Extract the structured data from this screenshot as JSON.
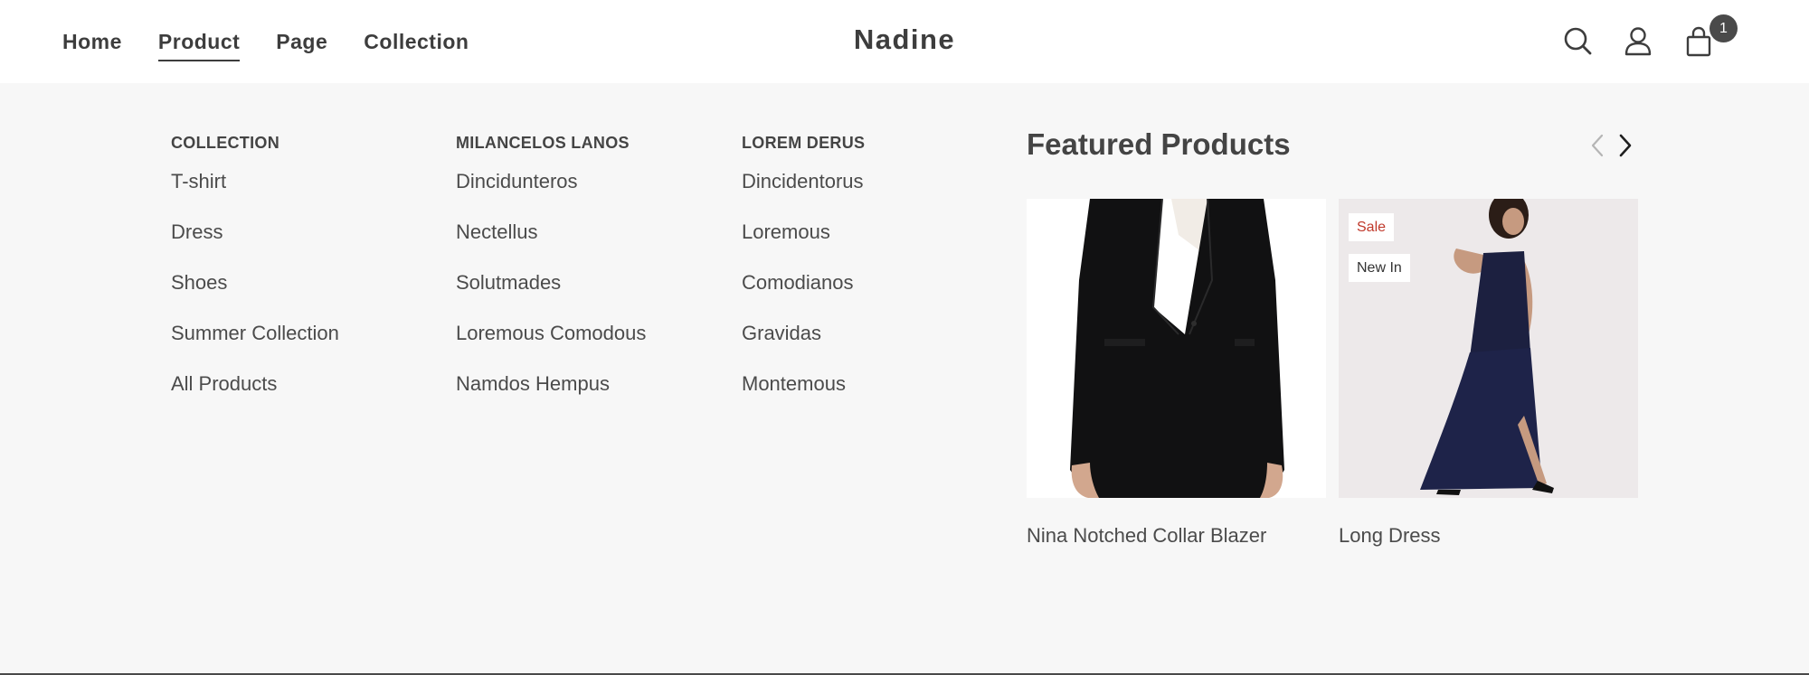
{
  "header": {
    "nav": [
      "Home",
      "Product",
      "Page",
      "Collection"
    ],
    "active_nav": "Product",
    "logo": "Nadine",
    "icons": [
      "search-icon",
      "user-icon",
      "cart-icon"
    ],
    "cart_count": "1"
  },
  "menu": {
    "columns": [
      {
        "heading": "COLLECTION",
        "items": [
          "T-shirt",
          "Dress",
          "Shoes",
          "Summer Collection",
          "All Products"
        ]
      },
      {
        "heading": "MILANCELOS LANOS",
        "items": [
          "Dincidunteros",
          "Nectellus",
          "Solutmades",
          "Loremous Comodous",
          "Namdos Hempus"
        ]
      },
      {
        "heading": "LOREM DERUS",
        "items": [
          "Dincidentorus",
          "Loremous",
          "Comodianos",
          "Gravidas",
          "Montemous"
        ]
      }
    ]
  },
  "featured": {
    "title": "Featured Products",
    "products": [
      {
        "name": "Nina Notched Collar Blazer",
        "image": "black-blazer-photo",
        "badges": []
      },
      {
        "name": "Long Dress",
        "image": "navy-long-dress-photo",
        "badges": [
          "Sale",
          "New In"
        ]
      }
    ]
  },
  "colors": {
    "header_bg": "#ffffff",
    "menu_bg": "#f7f7f7",
    "text": "#444444",
    "sale": "#c0392b",
    "cart_badge": "#4a4a4a"
  }
}
